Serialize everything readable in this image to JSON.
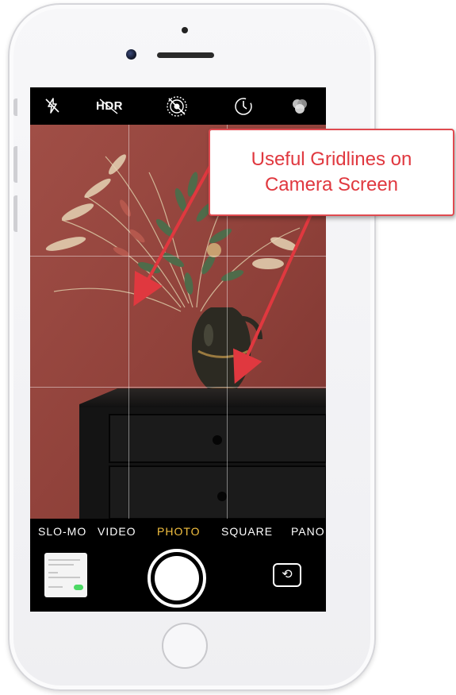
{
  "phone": {
    "camera": {
      "top_bar": {
        "icons": [
          "flash-off-icon",
          "hdr-icon",
          "live-photo-off-icon",
          "timer-icon",
          "filters-icon"
        ],
        "hdr_label": "HDR"
      },
      "grid": {
        "enabled": true,
        "rows": 3,
        "columns": 3
      },
      "modes": [
        "SLO-MO",
        "VIDEO",
        "PHOTO",
        "SQUARE",
        "PANO"
      ],
      "active_mode": "PHOTO"
    }
  },
  "annotation": {
    "text_line1": "Useful Gridlines on",
    "text_line2": "Camera Screen",
    "color": "#e0383f"
  },
  "colors": {
    "active_mode": "#f4c140",
    "wall": "#8a3f39",
    "annotation_red": "#e0383f"
  }
}
